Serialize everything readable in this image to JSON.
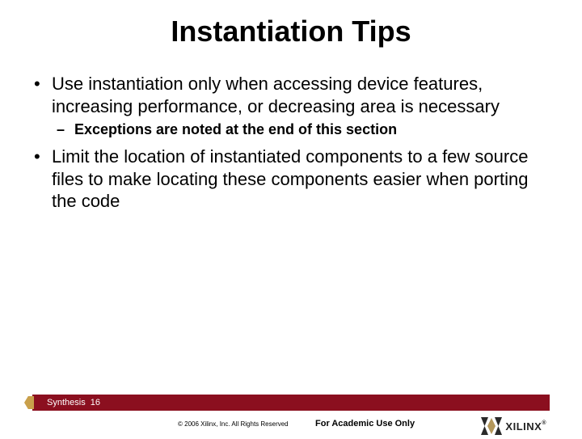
{
  "title": "Instantiation Tips",
  "bullets": {
    "b1": "Use instantiation only when accessing device features, increasing performance, or decreasing area is necessary",
    "b1_sub1": "Exceptions are noted at the end of this section",
    "b2": "Limit the location of instantiated components to a few source files to make locating these components easier when porting the code"
  },
  "footer": {
    "section": "Synthesis",
    "page": "16",
    "copyright": "© 2006 Xilinx, Inc. All Rights Reserved",
    "academic": "For Academic Use Only",
    "logo_text": "XILINX",
    "registered": "®"
  }
}
